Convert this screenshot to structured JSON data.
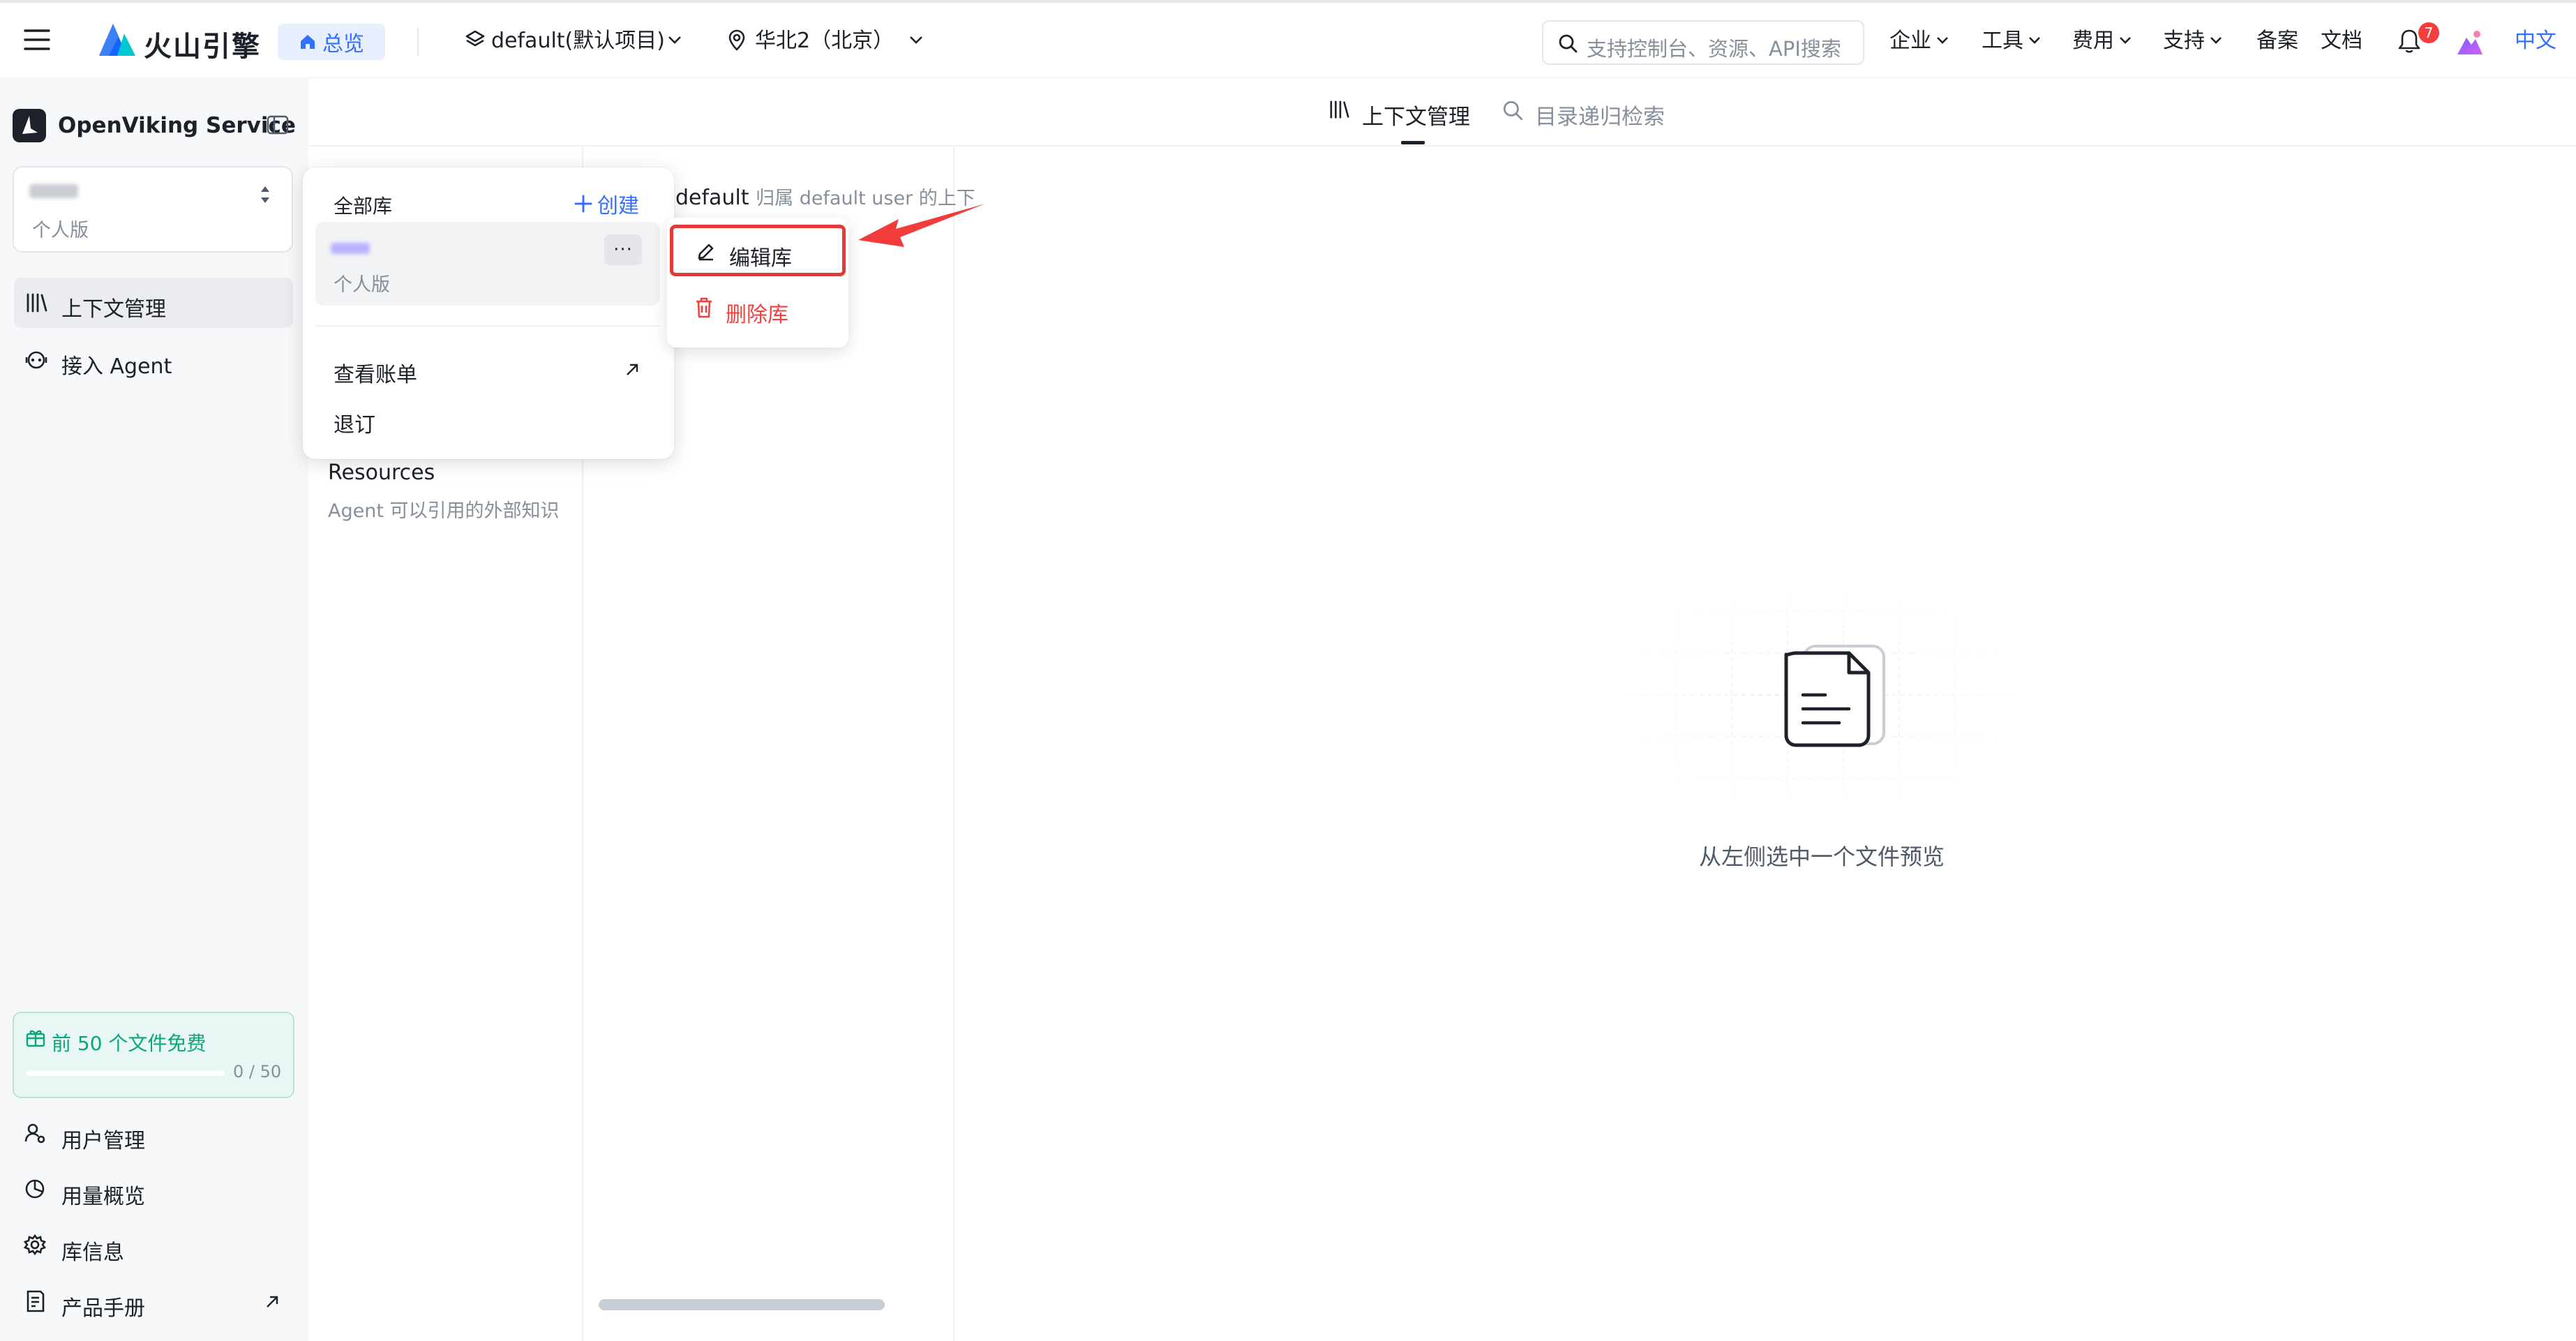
{
  "header": {
    "brand": "火山引擎",
    "home_label": "总览",
    "project_label": "default(默认项目)",
    "region_label": "华北2（北京）",
    "search_placeholder": "支持控制台、资源、API搜索",
    "nav": [
      "企业",
      "工具",
      "费用",
      "支持",
      "备案",
      "文档"
    ],
    "notification_count": "7",
    "language": "中文"
  },
  "sidebar": {
    "product": "OpenViking Service",
    "workspace_edition": "个人版",
    "items": [
      {
        "label": "上下文管理",
        "active": true
      },
      {
        "label": "接入 Agent",
        "active": false
      }
    ],
    "promo": {
      "text": "前 50 个文件免费",
      "count": "0 / 50",
      "progress": 0
    },
    "bottom_items": [
      {
        "label": "用户管理"
      },
      {
        "label": "用量概览"
      },
      {
        "label": "库信息"
      },
      {
        "label": "产品手册"
      }
    ]
  },
  "main": {
    "tabs": [
      {
        "label": "上下文管理",
        "active": true
      },
      {
        "label": "目录递归检索",
        "active": false
      }
    ],
    "resources_title": "Resources",
    "resources_desc": "Agent 可以引用的外部知识",
    "context_name": "default",
    "context_desc": "归属 default user 的上下",
    "empty_state": "从左侧选中一个文件预览"
  },
  "library_popover": {
    "heading": "全部库",
    "create_label": "创建",
    "item_edition": "个人版",
    "more_label": "···",
    "links": [
      {
        "label": "查看账单",
        "external": true
      },
      {
        "label": "退订",
        "external": false
      }
    ]
  },
  "context_menu": {
    "edit_label": "编辑库",
    "delete_label": "删除库"
  },
  "colors": {
    "accent": "#3370ff",
    "danger": "#f53f3f",
    "highlight_box": "#e53935",
    "promo_green": "#0aa57e"
  }
}
